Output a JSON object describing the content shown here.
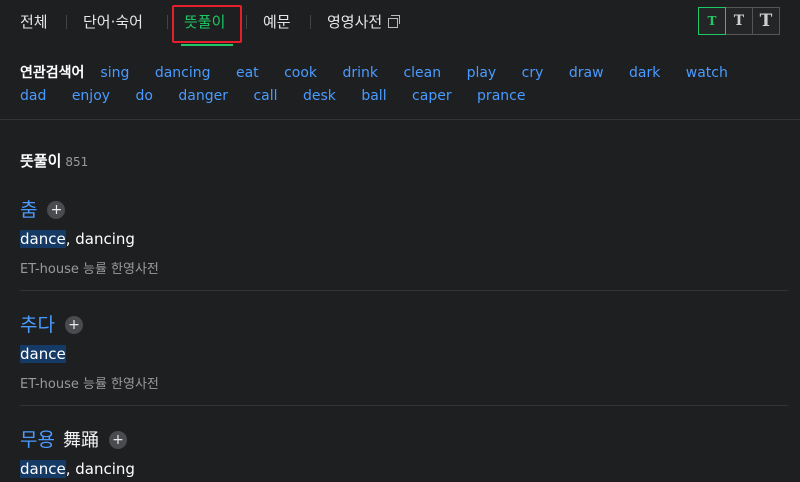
{
  "tabs": [
    {
      "label": "전체"
    },
    {
      "label": "단어·숙어"
    },
    {
      "label": "뜻풀이",
      "active": true
    },
    {
      "label": "예문"
    },
    {
      "label": "영영사전"
    }
  ],
  "font_size_buttons": [
    "T",
    "T",
    "T"
  ],
  "related": {
    "label": "연관검색어",
    "keywords": [
      "sing",
      "dancing",
      "eat",
      "cook",
      "drink",
      "clean",
      "play",
      "cry",
      "draw",
      "dark",
      "watch",
      "dad",
      "enjoy",
      "do",
      "danger",
      "call",
      "desk",
      "ball",
      "caper",
      "prance"
    ]
  },
  "section": {
    "title": "뜻풀이",
    "count": "851"
  },
  "entries": [
    {
      "headword": "춤",
      "hanja": "",
      "meaning_hl": "dance",
      "meaning_rest": ", dancing",
      "source": "ET-house 능률 한영사전"
    },
    {
      "headword": "추다",
      "hanja": "",
      "meaning_hl": "dance",
      "meaning_rest": "",
      "source": "ET-house 능률 한영사전"
    },
    {
      "headword": "무용",
      "hanja": "舞踊",
      "meaning_hl": "dance",
      "meaning_rest": ", dancing",
      "source": ""
    }
  ],
  "icons": {
    "plus": "+"
  }
}
